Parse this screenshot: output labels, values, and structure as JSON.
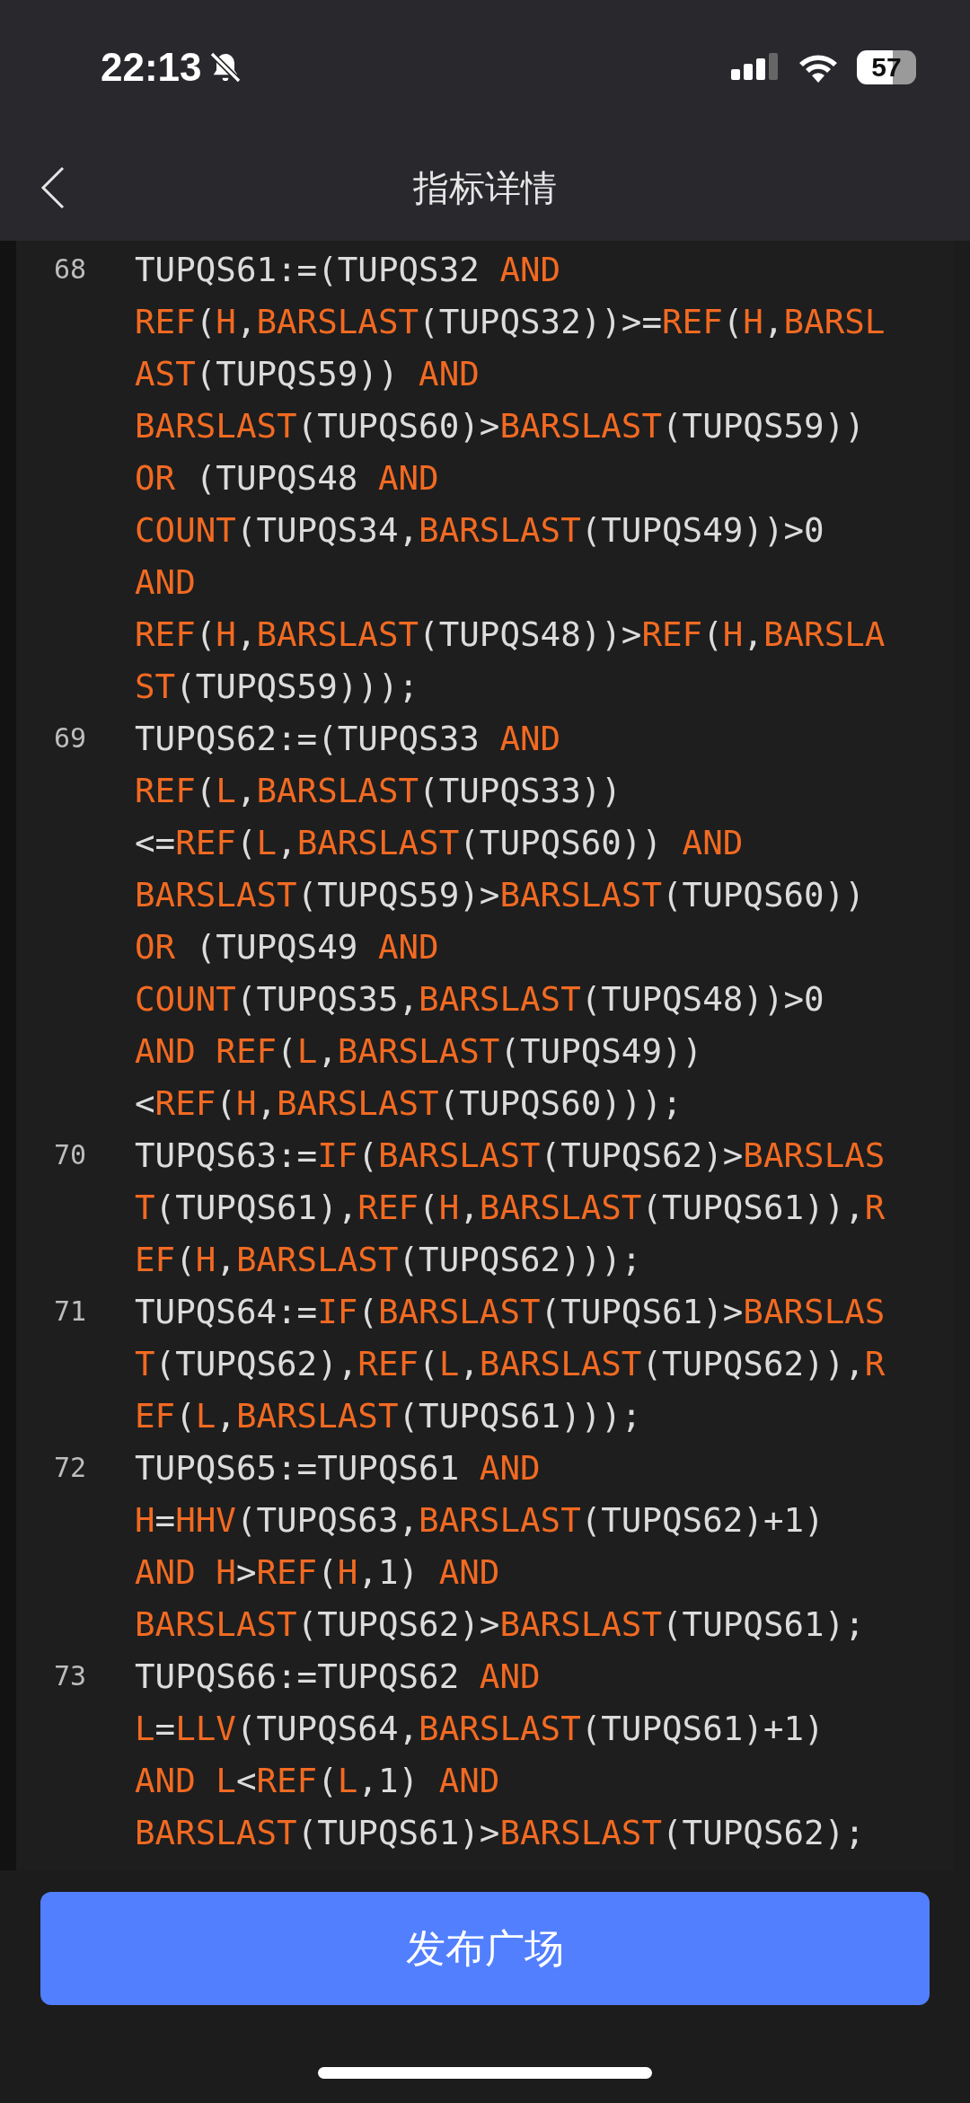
{
  "status_bar": {
    "time": "22:13",
    "battery_text": "57"
  },
  "nav": {
    "title": "指标详情"
  },
  "code": [
    {
      "number": "68",
      "lines": [
        [
          {
            "kind": "plain",
            "text": "TUPQS61:=(TUPQS32 "
          },
          {
            "kind": "keyword",
            "text": "AND"
          }
        ],
        [
          {
            "kind": "keyword",
            "text": "REF"
          },
          {
            "kind": "plain",
            "text": "("
          },
          {
            "kind": "keyword",
            "text": "H"
          },
          {
            "kind": "plain",
            "text": ","
          },
          {
            "kind": "keyword",
            "text": "BARSLAST"
          },
          {
            "kind": "plain",
            "text": "(TUPQS32))>="
          },
          {
            "kind": "keyword",
            "text": "REF"
          },
          {
            "kind": "plain",
            "text": "("
          },
          {
            "kind": "keyword",
            "text": "H"
          },
          {
            "kind": "plain",
            "text": ","
          },
          {
            "kind": "keyword",
            "text": "BARSL"
          }
        ],
        [
          {
            "kind": "keyword",
            "text": "AST"
          },
          {
            "kind": "plain",
            "text": "(TUPQS59)) "
          },
          {
            "kind": "keyword",
            "text": "AND"
          }
        ],
        [
          {
            "kind": "keyword",
            "text": "BARSLAST"
          },
          {
            "kind": "plain",
            "text": "(TUPQS60)>"
          },
          {
            "kind": "keyword",
            "text": "BARSLAST"
          },
          {
            "kind": "plain",
            "text": "(TUPQS59))"
          }
        ],
        [
          {
            "kind": "keyword",
            "text": "OR"
          },
          {
            "kind": "plain",
            "text": " (TUPQS48 "
          },
          {
            "kind": "keyword",
            "text": "AND"
          }
        ],
        [
          {
            "kind": "keyword",
            "text": "COUNT"
          },
          {
            "kind": "plain",
            "text": "(TUPQS34,"
          },
          {
            "kind": "keyword",
            "text": "BARSLAST"
          },
          {
            "kind": "plain",
            "text": "(TUPQS49))>0"
          }
        ],
        [
          {
            "kind": "keyword",
            "text": "AND"
          }
        ],
        [
          {
            "kind": "keyword",
            "text": "REF"
          },
          {
            "kind": "plain",
            "text": "("
          },
          {
            "kind": "keyword",
            "text": "H"
          },
          {
            "kind": "plain",
            "text": ","
          },
          {
            "kind": "keyword",
            "text": "BARSLAST"
          },
          {
            "kind": "plain",
            "text": "(TUPQS48))>"
          },
          {
            "kind": "keyword",
            "text": "REF"
          },
          {
            "kind": "plain",
            "text": "("
          },
          {
            "kind": "keyword",
            "text": "H"
          },
          {
            "kind": "plain",
            "text": ","
          },
          {
            "kind": "keyword",
            "text": "BARSLA"
          }
        ],
        [
          {
            "kind": "keyword",
            "text": "ST"
          },
          {
            "kind": "plain",
            "text": "(TUPQS59)));"
          }
        ]
      ]
    },
    {
      "number": "69",
      "lines": [
        [
          {
            "kind": "plain",
            "text": "TUPQS62:=(TUPQS33 "
          },
          {
            "kind": "keyword",
            "text": "AND"
          }
        ],
        [
          {
            "kind": "keyword",
            "text": "REF"
          },
          {
            "kind": "plain",
            "text": "("
          },
          {
            "kind": "keyword",
            "text": "L"
          },
          {
            "kind": "plain",
            "text": ","
          },
          {
            "kind": "keyword",
            "text": "BARSLAST"
          },
          {
            "kind": "plain",
            "text": "(TUPQS33))"
          }
        ],
        [
          {
            "kind": "plain",
            "text": "<="
          },
          {
            "kind": "keyword",
            "text": "REF"
          },
          {
            "kind": "plain",
            "text": "("
          },
          {
            "kind": "keyword",
            "text": "L"
          },
          {
            "kind": "plain",
            "text": ","
          },
          {
            "kind": "keyword",
            "text": "BARSLAST"
          },
          {
            "kind": "plain",
            "text": "(TUPQS60)) "
          },
          {
            "kind": "keyword",
            "text": "AND"
          }
        ],
        [
          {
            "kind": "keyword",
            "text": "BARSLAST"
          },
          {
            "kind": "plain",
            "text": "(TUPQS59)>"
          },
          {
            "kind": "keyword",
            "text": "BARSLAST"
          },
          {
            "kind": "plain",
            "text": "(TUPQS60))"
          }
        ],
        [
          {
            "kind": "keyword",
            "text": "OR"
          },
          {
            "kind": "plain",
            "text": " (TUPQS49 "
          },
          {
            "kind": "keyword",
            "text": "AND"
          }
        ],
        [
          {
            "kind": "keyword",
            "text": "COUNT"
          },
          {
            "kind": "plain",
            "text": "(TUPQS35,"
          },
          {
            "kind": "keyword",
            "text": "BARSLAST"
          },
          {
            "kind": "plain",
            "text": "(TUPQS48))>0"
          }
        ],
        [
          {
            "kind": "keyword",
            "text": "AND"
          },
          {
            "kind": "keyword",
            "text": " REF"
          },
          {
            "kind": "plain",
            "text": "("
          },
          {
            "kind": "keyword",
            "text": "L"
          },
          {
            "kind": "plain",
            "text": ","
          },
          {
            "kind": "keyword",
            "text": "BARSLAST"
          },
          {
            "kind": "plain",
            "text": "(TUPQS49))"
          }
        ],
        [
          {
            "kind": "plain",
            "text": "<"
          },
          {
            "kind": "keyword",
            "text": "REF"
          },
          {
            "kind": "plain",
            "text": "("
          },
          {
            "kind": "keyword",
            "text": "H"
          },
          {
            "kind": "plain",
            "text": ","
          },
          {
            "kind": "keyword",
            "text": "BARSLAST"
          },
          {
            "kind": "plain",
            "text": "(TUPQS60)));"
          }
        ]
      ]
    },
    {
      "number": "70",
      "lines": [
        [
          {
            "kind": "plain",
            "text": "TUPQS63:="
          },
          {
            "kind": "keyword",
            "text": "IF"
          },
          {
            "kind": "plain",
            "text": "("
          },
          {
            "kind": "keyword",
            "text": "BARSLAST"
          },
          {
            "kind": "plain",
            "text": "(TUPQS62)>"
          },
          {
            "kind": "keyword",
            "text": "BARSLAS"
          }
        ],
        [
          {
            "kind": "keyword",
            "text": "T"
          },
          {
            "kind": "plain",
            "text": "(TUPQS61),"
          },
          {
            "kind": "keyword",
            "text": "REF"
          },
          {
            "kind": "plain",
            "text": "("
          },
          {
            "kind": "keyword",
            "text": "H"
          },
          {
            "kind": "plain",
            "text": ","
          },
          {
            "kind": "keyword",
            "text": "BARSLAST"
          },
          {
            "kind": "plain",
            "text": "(TUPQS61)),"
          },
          {
            "kind": "keyword",
            "text": "R"
          }
        ],
        [
          {
            "kind": "keyword",
            "text": "EF"
          },
          {
            "kind": "plain",
            "text": "("
          },
          {
            "kind": "keyword",
            "text": "H"
          },
          {
            "kind": "plain",
            "text": ","
          },
          {
            "kind": "keyword",
            "text": "BARSLAST"
          },
          {
            "kind": "plain",
            "text": "(TUPQS62)));"
          }
        ]
      ]
    },
    {
      "number": "71",
      "lines": [
        [
          {
            "kind": "plain",
            "text": "TUPQS64:="
          },
          {
            "kind": "keyword",
            "text": "IF"
          },
          {
            "kind": "plain",
            "text": "("
          },
          {
            "kind": "keyword",
            "text": "BARSLAST"
          },
          {
            "kind": "plain",
            "text": "(TUPQS61)>"
          },
          {
            "kind": "keyword",
            "text": "BARSLAS"
          }
        ],
        [
          {
            "kind": "keyword",
            "text": "T"
          },
          {
            "kind": "plain",
            "text": "(TUPQS62),"
          },
          {
            "kind": "keyword",
            "text": "REF"
          },
          {
            "kind": "plain",
            "text": "("
          },
          {
            "kind": "keyword",
            "text": "L"
          },
          {
            "kind": "plain",
            "text": ","
          },
          {
            "kind": "keyword",
            "text": "BARSLAST"
          },
          {
            "kind": "plain",
            "text": "(TUPQS62)),"
          },
          {
            "kind": "keyword",
            "text": "R"
          }
        ],
        [
          {
            "kind": "keyword",
            "text": "EF"
          },
          {
            "kind": "plain",
            "text": "("
          },
          {
            "kind": "keyword",
            "text": "L"
          },
          {
            "kind": "plain",
            "text": ","
          },
          {
            "kind": "keyword",
            "text": "BARSLAST"
          },
          {
            "kind": "plain",
            "text": "(TUPQS61)));"
          }
        ]
      ]
    },
    {
      "number": "72",
      "lines": [
        [
          {
            "kind": "plain",
            "text": "TUPQS65:=TUPQS61 "
          },
          {
            "kind": "keyword",
            "text": "AND"
          }
        ],
        [
          {
            "kind": "keyword",
            "text": "H"
          },
          {
            "kind": "plain",
            "text": "="
          },
          {
            "kind": "keyword",
            "text": "HHV"
          },
          {
            "kind": "plain",
            "text": "(TUPQS63,"
          },
          {
            "kind": "keyword",
            "text": "BARSLAST"
          },
          {
            "kind": "plain",
            "text": "(TUPQS62)+1)"
          }
        ],
        [
          {
            "kind": "keyword",
            "text": "AND"
          },
          {
            "kind": "keyword",
            "text": " H"
          },
          {
            "kind": "plain",
            "text": ">"
          },
          {
            "kind": "keyword",
            "text": "REF"
          },
          {
            "kind": "plain",
            "text": "("
          },
          {
            "kind": "keyword",
            "text": "H"
          },
          {
            "kind": "plain",
            "text": ",1) "
          },
          {
            "kind": "keyword",
            "text": "AND"
          }
        ],
        [
          {
            "kind": "keyword",
            "text": "BARSLAST"
          },
          {
            "kind": "plain",
            "text": "(TUPQS62)>"
          },
          {
            "kind": "keyword",
            "text": "BARSLAST"
          },
          {
            "kind": "plain",
            "text": "(TUPQS61);"
          }
        ]
      ]
    },
    {
      "number": "73",
      "lines": [
        [
          {
            "kind": "plain",
            "text": "TUPQS66:=TUPQS62 "
          },
          {
            "kind": "keyword",
            "text": "AND"
          }
        ],
        [
          {
            "kind": "keyword",
            "text": "L"
          },
          {
            "kind": "plain",
            "text": "="
          },
          {
            "kind": "keyword",
            "text": "LLV"
          },
          {
            "kind": "plain",
            "text": "(TUPQS64,"
          },
          {
            "kind": "keyword",
            "text": "BARSLAST"
          },
          {
            "kind": "plain",
            "text": "(TUPQS61)+1)"
          }
        ],
        [
          {
            "kind": "keyword",
            "text": "AND"
          },
          {
            "kind": "keyword",
            "text": " L"
          },
          {
            "kind": "plain",
            "text": "<"
          },
          {
            "kind": "keyword",
            "text": "REF"
          },
          {
            "kind": "plain",
            "text": "("
          },
          {
            "kind": "keyword",
            "text": "L"
          },
          {
            "kind": "plain",
            "text": ",1) "
          },
          {
            "kind": "keyword",
            "text": "AND"
          }
        ],
        [
          {
            "kind": "keyword",
            "text": "BARSLAST"
          },
          {
            "kind": "plain",
            "text": "(TUPQS61)>"
          },
          {
            "kind": "keyword",
            "text": "BARSLAST"
          },
          {
            "kind": "plain",
            "text": "(TUPQS62);"
          }
        ]
      ]
    }
  ],
  "publish_button": {
    "label": "发布广场"
  }
}
